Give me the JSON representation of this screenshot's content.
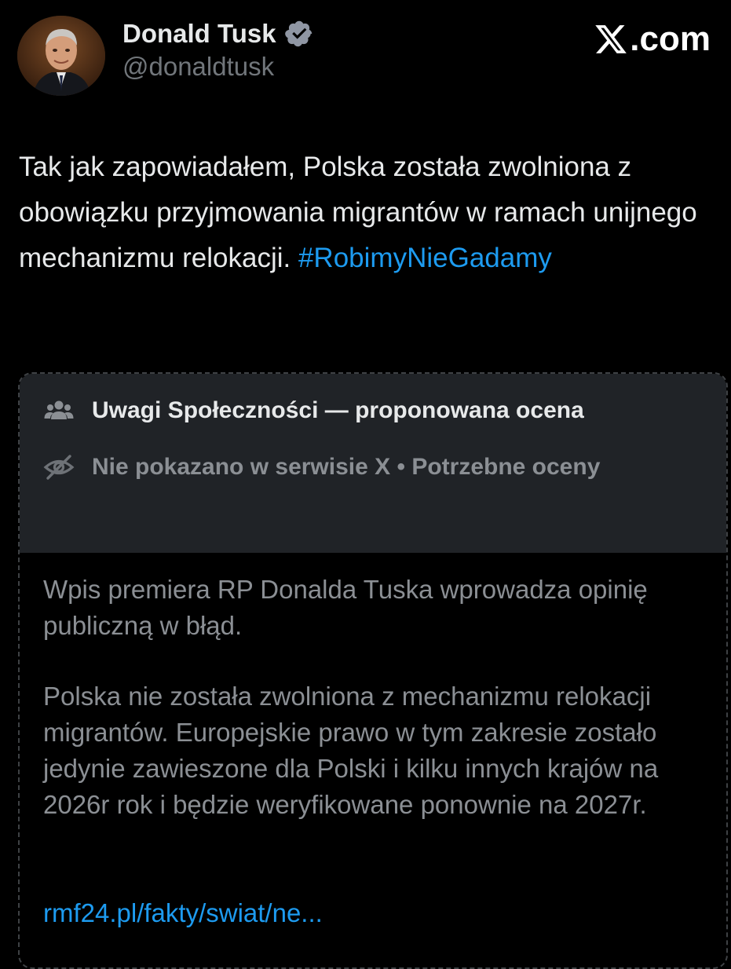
{
  "author": {
    "display_name": "Donald Tusk",
    "handle": "@donaldtusk",
    "verified_icon": "verified-badge-icon",
    "avatar": "avatar-photo"
  },
  "source": {
    "label": ".com",
    "logo_icon": "x-logo-icon"
  },
  "tweet": {
    "text": "Tak jak zapowiadałem, Polska została zwolniona z obowiązku przyjmowania migrantów w ramach unijnego mechanizmu relokacji. ",
    "hashtag": "#RobimyNieGadamy"
  },
  "community_note": {
    "title": "Uwagi Społeczności — proponowana ocena",
    "title_icon": "community-people-icon",
    "status": "Nie pokazano w serwisie X • Potrzebne oceny",
    "status_icon": "eye-off-icon",
    "paragraphs": [
      "Wpis premiera RP Donalda Tuska wprowadza opinię publiczną w błąd.",
      "Polska nie została zwolniona z mechanizmu relokacji migrantów. Europejskie prawo w tym zakresie zostało jedynie zawieszone dla Polski i kilku innych krajów na 2026r rok i będzie weryfikowane ponownie na 2027r."
    ],
    "link": "rmf24.pl/fakty/swiat/ne..."
  },
  "colors": {
    "background": "#000000",
    "text_primary": "#e7e9ea",
    "text_secondary": "#71767b",
    "note_text": "#8b8f94",
    "link": "#1d9bf0",
    "note_header_bg": "#202327",
    "verified": "#8f96a3"
  }
}
